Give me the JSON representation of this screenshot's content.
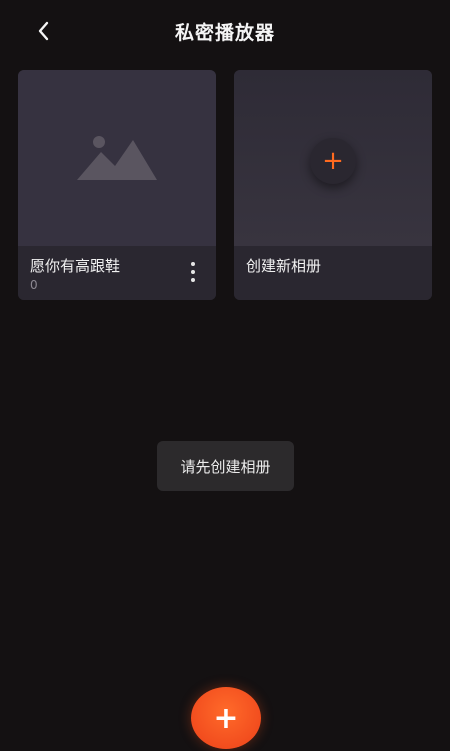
{
  "header": {
    "title": "私密播放器",
    "back_icon": "chevron-left-icon"
  },
  "albums": [
    {
      "name": "愿你有高跟鞋",
      "count": "0",
      "cover_icon": "image-placeholder-icon",
      "menu_icon": "more-vertical-icon"
    },
    {
      "name": "创建新相册",
      "add_symbol": "+",
      "add_icon": "plus-icon"
    }
  ],
  "toast": {
    "message": "请先创建相册"
  },
  "fab": {
    "symbol": "+",
    "icon": "plus-icon"
  },
  "colors": {
    "background": "#141112",
    "card": "#2a2730",
    "accent": "#ff6a1f",
    "fab": "#f24d1e"
  }
}
